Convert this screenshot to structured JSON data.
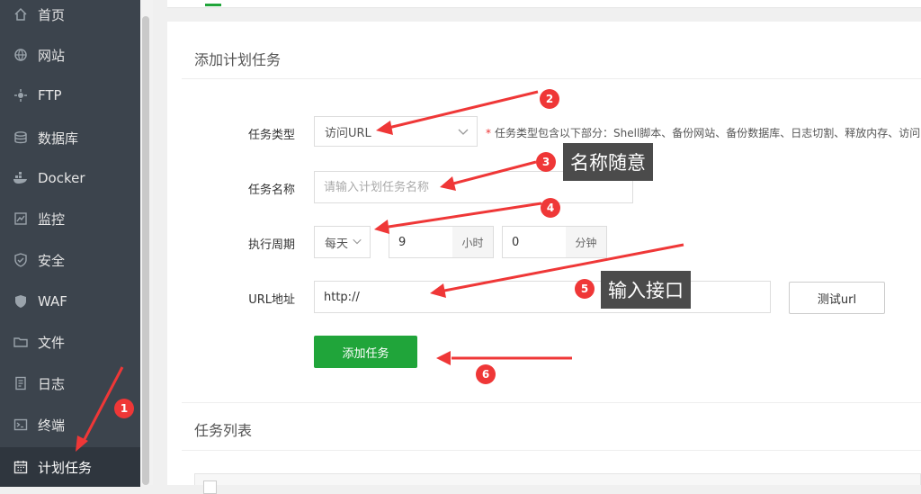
{
  "sidebar": {
    "items": [
      {
        "label": "首页",
        "icon": "home-icon"
      },
      {
        "label": "网站",
        "icon": "globe-icon"
      },
      {
        "label": "FTP",
        "icon": "ftp-icon"
      },
      {
        "label": "数据库",
        "icon": "database-icon"
      },
      {
        "label": "Docker",
        "icon": "docker-icon"
      },
      {
        "label": "监控",
        "icon": "monitor-icon"
      },
      {
        "label": "安全",
        "icon": "shield-icon"
      },
      {
        "label": "WAF",
        "icon": "waf-shield-icon"
      },
      {
        "label": "文件",
        "icon": "folder-icon"
      },
      {
        "label": "日志",
        "icon": "log-icon"
      },
      {
        "label": "终端",
        "icon": "terminal-icon"
      },
      {
        "label": "计划任务",
        "icon": "calendar-icon",
        "active": true
      }
    ]
  },
  "form": {
    "title": "添加计划任务",
    "task_type": {
      "label": "任务类型",
      "value": "访问URL",
      "hint_star": "*",
      "hint": "任务类型包含以下部分：Shell脚本、备份网站、备份数据库、日志切割、释放内存、访问"
    },
    "task_name": {
      "label": "任务名称",
      "placeholder": "请输入计划任务名称"
    },
    "period": {
      "label": "执行周期",
      "frequency": "每天",
      "hour": "9",
      "hour_unit": "小时",
      "minute": "0",
      "minute_unit": "分钟"
    },
    "url": {
      "label": "URL地址",
      "value": "http://",
      "test_button": "测试url"
    },
    "submit": "添加任务"
  },
  "task_list": {
    "title": "任务列表"
  },
  "annotations": {
    "badges": [
      "1",
      "2",
      "3",
      "4",
      "5",
      "6"
    ],
    "callouts": {
      "name": "名称随意",
      "url": "输入接口"
    },
    "color": "#ef3737"
  },
  "colors": {
    "sidebar": "#3c444d",
    "sidebar_active": "#2f363e",
    "accent": "#20a53a"
  }
}
